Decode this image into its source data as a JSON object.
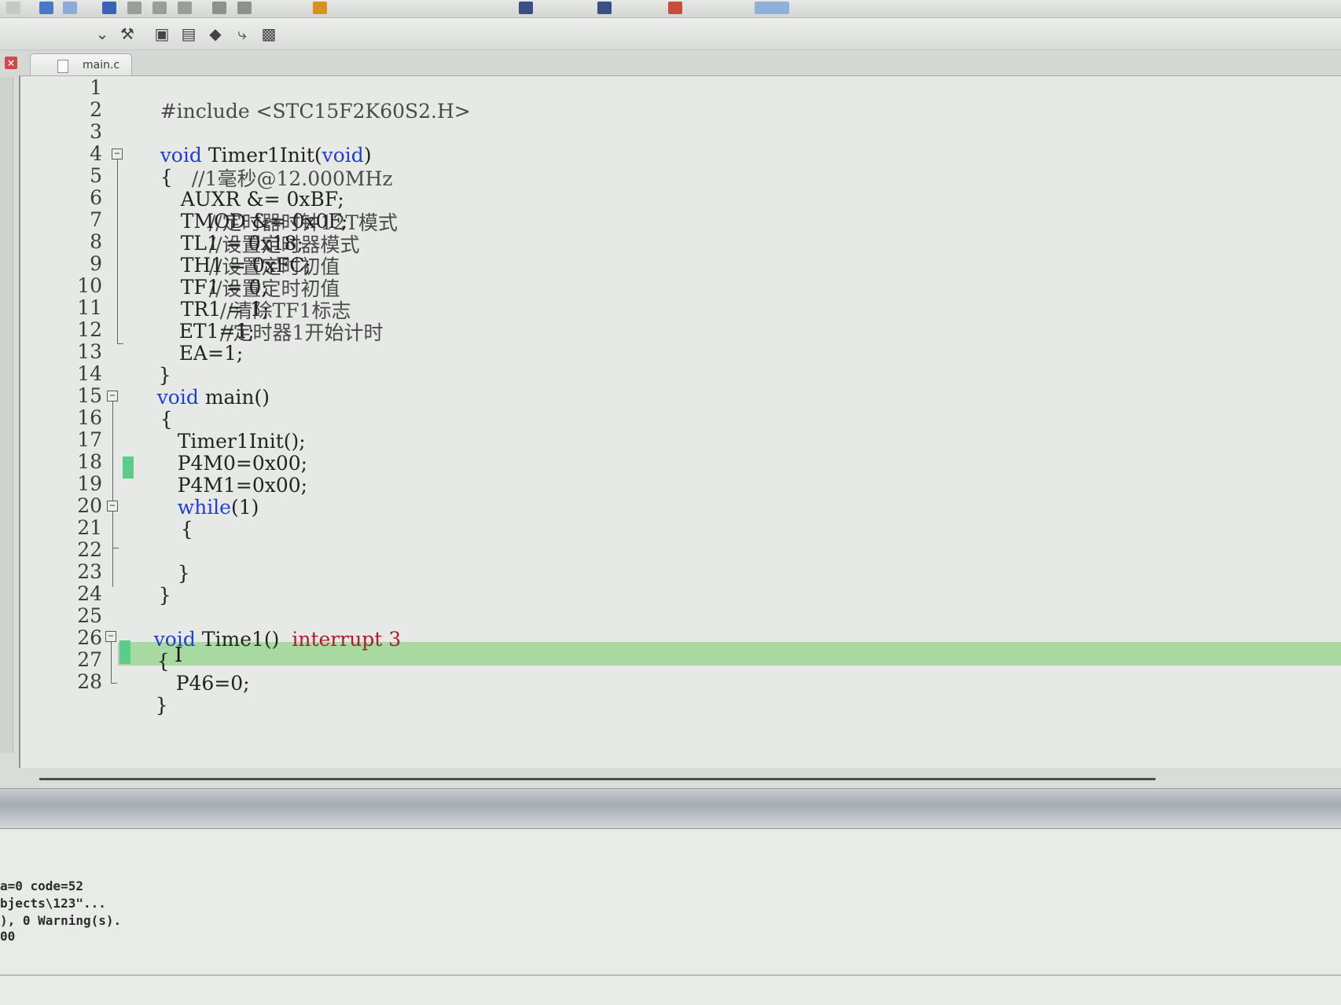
{
  "tab": {
    "label": "main.c"
  },
  "toolbar": {
    "icons": [
      "undo-icon",
      "redo-icon",
      "bookmark-icon",
      "indent-icon",
      "outdent-icon",
      "comment-icon",
      "uncomment-icon",
      "build-icon",
      "download-icon",
      "debug-icon"
    ],
    "second_row_icons": [
      "dropdown-icon",
      "options-icon",
      "pack-installer-icon",
      "select-device-icon",
      "manage-components-icon",
      "run-time-env-icon",
      "books-icon"
    ]
  },
  "editor": {
    "line_numbers": [
      "1",
      "2",
      "3",
      "4",
      "5",
      "6",
      "7",
      "8",
      "9",
      "10",
      "11",
      "12",
      "13",
      "14",
      "15",
      "16",
      "17",
      "18",
      "19",
      "20",
      "21",
      "22",
      "23",
      "24",
      "25",
      "26",
      "27",
      "28"
    ],
    "lines": {
      "l1": "#include <STC15F2K60S2.H>",
      "l3_kw1": "void",
      "l3_name": " Timer1Init(",
      "l3_kw2": "void",
      "l3_close": ")",
      "l3_comment": "//1毫秒@12.000MHz",
      "l4": "{",
      "l5_code": "AUXR &= 0xBF;",
      "l5_comment": "//定时器时钟12T模式",
      "l6_code": "TMOD &= 0x0F;",
      "l6_comment": "//设置定时器模式",
      "l7_code": "TL1 = 0x18;",
      "l7_comment": "//设置定时初值",
      "l8_code": "TH1 = 0xFC;",
      "l8_comment": "//设置定时初值",
      "l9_code": "TF1 = 0;",
      "l9_comment": "//清除TF1标志",
      "l10_code": "TR1 = 1;",
      "l10_comment": "//定时器1开始计时",
      "l11": "ET1=1;",
      "l12": "EA=1;",
      "l13": "}",
      "l14_kw": "void",
      "l14_rest": " main()",
      "l15": "{",
      "l16": "Timer1Init();",
      "l17": "P4M0=0x00;",
      "l18": "P4M1=0x00;",
      "l19_kw": "while",
      "l19_rest": "(1)",
      "l20": "{",
      "l22": "}",
      "l23": "}",
      "l25_kw": "void",
      "l25_name": " Time1() ",
      "l25_interrupt": "interrupt 3",
      "l26": "{",
      "l27": "P46=0;",
      "l28": "}"
    },
    "cursor": "I"
  },
  "output": {
    "lines": [
      "a=0 code=52",
      "bjects\\123\"...",
      "), 0 Warning(s).",
      "00"
    ]
  },
  "colors": {
    "keyword": "#1f3fd6",
    "interrupt": "#b01a2a",
    "current_line": "#a8d9a0",
    "brace_match": "#5ccc8a"
  }
}
